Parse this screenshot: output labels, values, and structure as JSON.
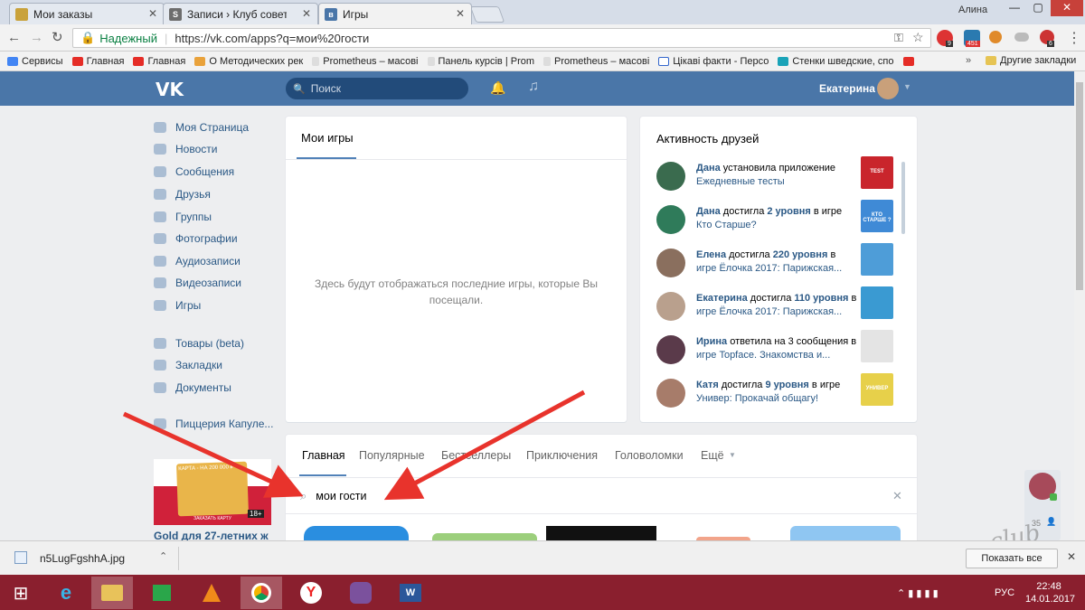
{
  "browser": {
    "tabs": [
      {
        "title": "Мои заказы",
        "favicon": "folder-icon"
      },
      {
        "title": "Записи › Клуб советов ›",
        "favicon": "s-icon"
      },
      {
        "title": "Игры",
        "favicon": "vk-icon"
      }
    ],
    "user": "Алина",
    "secure_label": "Надежный",
    "url": "https://vk.com/apps?q=мои%20гости",
    "ext_badges": [
      "9",
      "451",
      "6"
    ],
    "bookmarks": [
      "Сервисы",
      "Главная",
      "Главная",
      "О Методических рек",
      "Prometheus – масові",
      "Панель курсів | Prom",
      "Prometheus – масові",
      "Цікаві факти - Персо",
      "Стенки шведские, спо"
    ],
    "other_bookmarks": "Другие закладки"
  },
  "vk": {
    "logo": "VK",
    "search_placeholder": "Поиск",
    "user_name": "Екатерина",
    "sidebar": [
      {
        "label": "Моя Страница",
        "icon": "home-icon"
      },
      {
        "label": "Новости",
        "icon": "news-icon"
      },
      {
        "label": "Сообщения",
        "icon": "messages-icon"
      },
      {
        "label": "Друзья",
        "icon": "friends-icon"
      },
      {
        "label": "Группы",
        "icon": "groups-icon"
      },
      {
        "label": "Фотографии",
        "icon": "camera-icon"
      },
      {
        "label": "Аудиозаписи",
        "icon": "music-icon"
      },
      {
        "label": "Видеозаписи",
        "icon": "video-icon"
      },
      {
        "label": "Игры",
        "icon": "gamepad-icon"
      },
      {
        "label": "Товары (beta)",
        "icon": "shop-icon"
      },
      {
        "label": "Закладки",
        "icon": "star-icon"
      },
      {
        "label": "Документы",
        "icon": "document-icon"
      },
      {
        "label": "Пиццерия Капуле...",
        "icon": "group-icon"
      }
    ],
    "ad": {
      "banner_top": "КАРТА - НА 200 000 ₽",
      "banner_btn": "ЗАКАЗАТЬ КАРТУ",
      "age": "18+",
      "caption": "Gold для 27-летних ж"
    },
    "my_games": {
      "title": "Мои игры",
      "empty_text": "Здесь будут отображаться последние игры, которые Вы посещали."
    },
    "friends_activity": {
      "title": "Активность друзей",
      "items": [
        {
          "name": "Дана",
          "action": "установила приложение",
          "target": "Ежедневные тесты",
          "thumb_label": "TEST"
        },
        {
          "name": "Дана",
          "action": "достигла",
          "level": "2 уровня",
          "mid": "в игре",
          "target": "Кто Старше?",
          "thumb_label": "КТО СТАРШЕ ?"
        },
        {
          "name": "Елена",
          "action": "достигла",
          "level": "220 уровня",
          "mid": "в",
          "target": "игре Ёлочка 2017: Парижская...",
          "thumb_label": ""
        },
        {
          "name": "Екатерина",
          "action": "достигла",
          "level": "110 уровня",
          "mid": "в",
          "target": "игре Ёлочка 2017: Парижская...",
          "thumb_label": ""
        },
        {
          "name": "Ирина",
          "action": "ответила на 3 сообщения",
          "mid": "в",
          "target": "игре Topface. Знакомства и...",
          "thumb_label": ""
        },
        {
          "name": "Катя",
          "action": "достигла",
          "level": "9 уровня",
          "mid": "в игре",
          "target": "Универ: Прокачай общагу!",
          "thumb_label": "УНИВЕР"
        }
      ]
    },
    "catalog_tabs": [
      "Главная",
      "Популярные",
      "Бестселлеры",
      "Приключения",
      "Головоломки",
      "Ещё"
    ],
    "game_search_value": "мои гости",
    "right_widget_count": "35"
  },
  "download": {
    "file": "n5LugFgshhA.jpg",
    "show_all": "Показать все"
  },
  "watermark": "club sovet",
  "taskbar": {
    "lang": "РУС",
    "time": "22:48",
    "date": "14.01.2017"
  },
  "colors": {
    "vk_blue": "#4a76a8",
    "arrow_red": "#e8332c",
    "taskbar": "#8a1f2e"
  }
}
